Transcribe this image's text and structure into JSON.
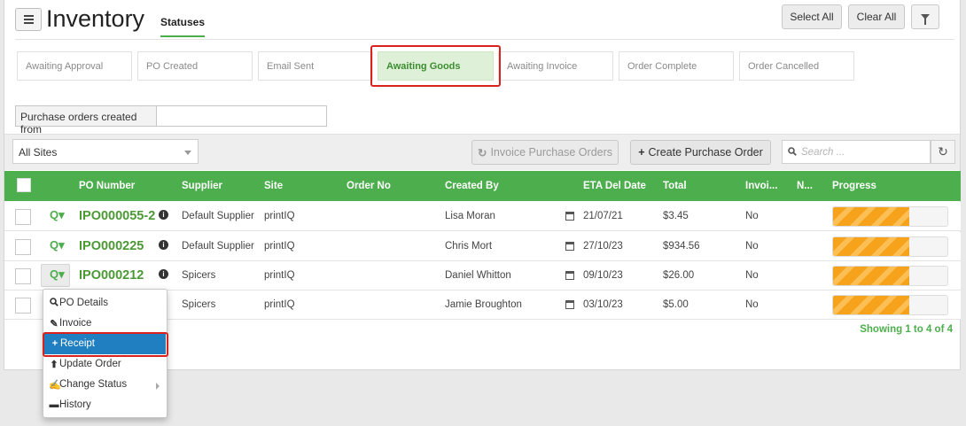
{
  "header": {
    "title": "Inventory",
    "tab": "Statuses",
    "select_all": "Select All",
    "clear_all": "Clear All"
  },
  "statuses": [
    {
      "label": "Awaiting Approval",
      "active": false
    },
    {
      "label": "PO Created",
      "active": false
    },
    {
      "label": "Email Sent",
      "active": false
    },
    {
      "label": "Awaiting Goods",
      "active": true
    },
    {
      "label": "Awaiting Invoice",
      "active": false
    },
    {
      "label": "Order Complete",
      "active": false
    },
    {
      "label": "Order Cancelled",
      "active": false
    }
  ],
  "filter": {
    "created_from_label": "Purchase orders created from",
    "created_from_value": ""
  },
  "toolbar": {
    "site_selected": "All Sites",
    "invoice_po_label": "Invoice Purchase Orders",
    "create_po_label": "Create Purchase Order",
    "search_placeholder": "Search ..."
  },
  "table": {
    "columns": [
      "PO Number",
      "Supplier",
      "Site",
      "Order No",
      "Created By",
      "ETA Del Date",
      "Total",
      "Invoi...",
      "N...",
      "Progress"
    ],
    "rows": [
      {
        "po": "IPO000055-2",
        "supplier": "Default Supplier",
        "site": "printIQ",
        "order_no": "",
        "created_by": "Lisa Moran",
        "eta": "21/07/21",
        "total": "$3.45",
        "invoiced": "No",
        "progress": 0.67
      },
      {
        "po": "IPO000225",
        "supplier": "Default Supplier",
        "site": "printIQ",
        "order_no": "",
        "created_by": "Chris Mort",
        "eta": "27/10/23",
        "total": "$934.56",
        "invoiced": "No",
        "progress": 0.67
      },
      {
        "po": "IPO000212",
        "supplier": "Spicers",
        "site": "printIQ",
        "order_no": "",
        "created_by": "Daniel Whitton",
        "eta": "09/10/23",
        "total": "$26.00",
        "invoiced": "No",
        "progress": 0.67
      },
      {
        "po": "",
        "supplier": "Spicers",
        "site": "printIQ",
        "order_no": "",
        "created_by": "Jamie Broughton",
        "eta": "03/10/23",
        "total": "$5.00",
        "invoiced": "No",
        "progress": 0.67
      }
    ],
    "showing": "Showing 1 to 4 of 4"
  },
  "dropdown": {
    "items": [
      {
        "label": "PO Details",
        "icon": "search-icon"
      },
      {
        "label": "Invoice",
        "icon": "pencil-icon"
      },
      {
        "label": "Receipt",
        "icon": "plus-icon",
        "active": true
      },
      {
        "label": "Update Order",
        "icon": "arrow-circle-icon"
      },
      {
        "label": "Change Status",
        "icon": "edit-icon",
        "submenu": true
      },
      {
        "label": "History",
        "icon": "folder-icon"
      }
    ]
  },
  "colors": {
    "brand_green": "#4cae4c",
    "highlight_red": "#d9211e",
    "menu_active_blue": "#1f7fc0",
    "progress_orange": "#f7a21b"
  }
}
